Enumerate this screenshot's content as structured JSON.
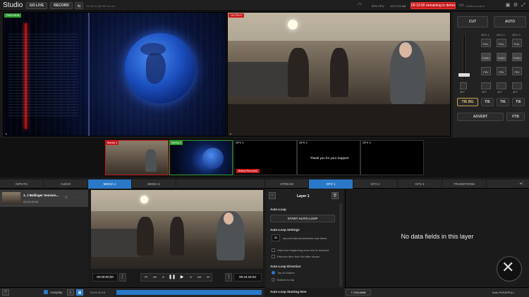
{
  "app": {
    "title": "Studio"
  },
  "topbar": {
    "go_live": "GO LIVE",
    "record": "RECORD",
    "timestamp": "12:25:11 (00 left on deo",
    "cpu": "52% CPU",
    "clock": "12:17:24 AM",
    "demo_badge": "00:10:00 remaining in demo",
    "project": "Untitled project"
  },
  "preview": {
    "label": "PREVIEW"
  },
  "output": {
    "label": "OUTPUT"
  },
  "controls": {
    "cut": "CUT",
    "auto": "AUTO",
    "gfx_headers": [
      "GFX 1",
      "GFX 2",
      "GFX 3"
    ],
    "pull_label": "PULL",
    "push_label": "PUSH",
    "prv_label": "PRV",
    "fade_labels": [
      "45 F",
      "45 F",
      "45 F",
      "45 F"
    ],
    "tie_bg": "TIE BG",
    "tie": "TIE",
    "advert": "ADVERT",
    "ftb": "FTB"
  },
  "sources": {
    "media1": "Media 1",
    "media2": "Media 2",
    "gfx1": "GFX 1",
    "gfx2": "GFX 2",
    "gfx3": "GFX 3",
    "gfx2_text": "Thank you for your Support",
    "lower_third": "Belfast Recorded"
  },
  "left_tabs": [
    "INPUTS",
    "AUDIO",
    "MEDIA 1",
    "MEDIA 2"
  ],
  "right_tabs": [
    "STREAM",
    "GFX 1",
    "GFX 2",
    "GFX 3",
    "TRANSITIONS"
  ],
  "media_item": {
    "title": "1. J Ballinger Session...",
    "duration": "00:44:16:04"
  },
  "player": {
    "time_start": "00:00:00;00",
    "time_end": "00:44:16:04",
    "progress_time": "00:01:40:16"
  },
  "left_bottom": {
    "autoplay": "Autoplay"
  },
  "layer": {
    "title": "Layer 1",
    "empty_msg": "No data fields in this layer"
  },
  "autoloop": {
    "heading": "Auto-Loop",
    "start_button": "START AUTO-LOOP",
    "settings_heading": "Auto-Loop Settings",
    "interval_value": "30",
    "interval_label": "second interval between new items",
    "opt1": "Start from beginning once end is reached",
    "opt2": "Remove item from list after shown",
    "direction_heading": "Auto-Loop Direction",
    "dir1": "Top-to-bottom",
    "dir2": "Bottom-to-top",
    "starting_heading": "Auto-Loop Starting Item"
  },
  "bottom": {
    "column_btn": "+ COLUMN",
    "auto_push": "Auto PUSH/PULL"
  }
}
